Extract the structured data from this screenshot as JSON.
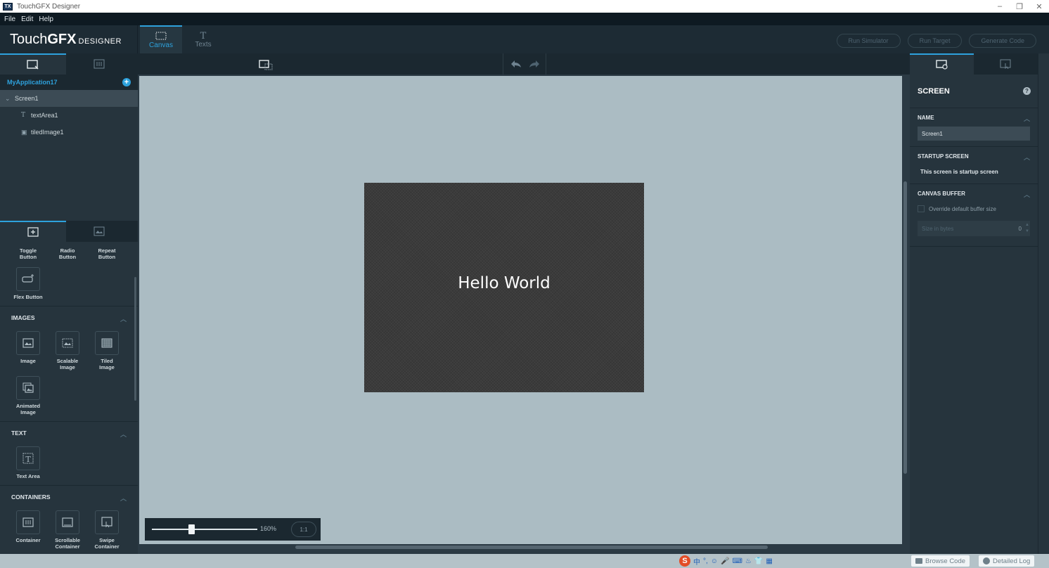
{
  "window": {
    "title": "TouchGFX Designer",
    "controls": [
      "–",
      "❐",
      "✕"
    ]
  },
  "menu": [
    "File",
    "Edit",
    "Help"
  ],
  "header": {
    "logo_main_pre": "Touch",
    "logo_main_bold": "GFX",
    "logo_sub": "DESIGNER",
    "tabs": [
      {
        "label": "Canvas",
        "active": true
      },
      {
        "label": "Texts",
        "active": false
      }
    ],
    "buttons": [
      "Run Simulator",
      "Run Target",
      "Generate Code"
    ]
  },
  "tree": {
    "app_name": "MyApplication17",
    "screen": "Screen1",
    "children": [
      "textArea1",
      "tiledImage1"
    ]
  },
  "widgets": {
    "buttons_partial": [
      "Toggle Button",
      "Radio Button",
      "Repeat Button"
    ],
    "flex": "Flex Button",
    "images_title": "IMAGES",
    "images": [
      "Image",
      "Scalable Image",
      "Tiled Image",
      "Animated Image"
    ],
    "text_title": "TEXT",
    "text": [
      "Text Area"
    ],
    "containers_title": "CONTAINERS",
    "containers": [
      "Container",
      "Scrollable Container",
      "Swipe Container"
    ]
  },
  "canvas": {
    "text": "Hello World",
    "zoom_pct": "160%",
    "zoom_value": 160,
    "one_to_one": "1:1"
  },
  "properties": {
    "title": "SCREEN",
    "name_label": "NAME",
    "name_value": "Screen1",
    "startup_label": "STARTUP SCREEN",
    "startup_text": "This screen is startup screen",
    "buffer_label": "CANVAS BUFFER",
    "override_label": "Override default buffer size",
    "size_placeholder": "Size in bytes",
    "size_value": "0"
  },
  "status": {
    "browse_code": "Browse Code",
    "detailed_log": "Detailed Log",
    "ime": [
      "S",
      "中",
      "°,",
      "☺",
      "🎤",
      "⌨",
      "♨",
      "👕",
      "▦"
    ]
  },
  "colors": {
    "accent": "#2ea2dd",
    "canvas_bg": "#abbcc3",
    "panel": "#26343d"
  }
}
